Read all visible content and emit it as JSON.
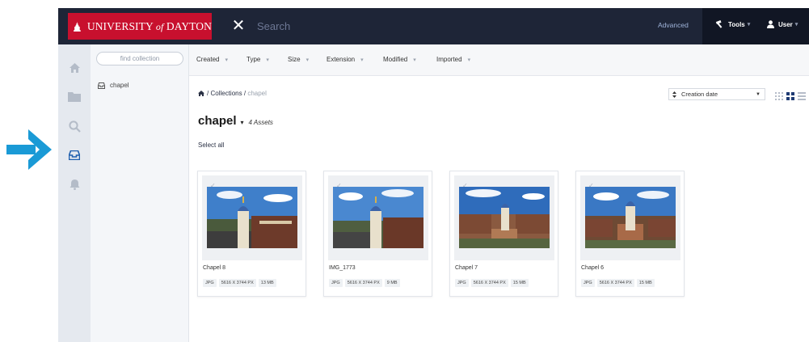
{
  "brand": {
    "name_part1": "UNIVERSITY",
    "name_of": "of",
    "name_part2": "DAYTON"
  },
  "search": {
    "placeholder": "Search"
  },
  "topbar": {
    "advanced": "Advanced",
    "tools": "Tools",
    "user": "User"
  },
  "collections_panel": {
    "find_placeholder": "find collection",
    "items": [
      {
        "label": "chapel"
      }
    ]
  },
  "filters": [
    "Created",
    "Type",
    "Size",
    "Extension",
    "Modified",
    "Imported"
  ],
  "breadcrumb": {
    "collections": "Collections",
    "separator": "/",
    "current": "chapel"
  },
  "sort": {
    "selected": "Creation date"
  },
  "collection": {
    "title": "chapel",
    "asset_count": "4 Assets",
    "select_all": "Select all"
  },
  "assets": [
    {
      "title": "Chapel 8",
      "type": "JPG",
      "dimensions": "5616 X 3744 PX",
      "size": "13 MB"
    },
    {
      "title": "IMG_1773",
      "type": "JPG",
      "dimensions": "5616 X 3744 PX",
      "size": "9 MB"
    },
    {
      "title": "Chapel 7",
      "type": "JPG",
      "dimensions": "5616 X 3744 PX",
      "size": "15 MB"
    },
    {
      "title": "Chapel 6",
      "type": "JPG",
      "dimensions": "5616 X 3744 PX",
      "size": "15 MB"
    }
  ],
  "icons": {
    "callout": "arrow-right-icon",
    "rail": [
      "home-icon",
      "folder-icon",
      "search-icon",
      "inbox-icon",
      "bell-icon"
    ],
    "tools": "hammer-icon",
    "user": "user-icon",
    "collection": "inbox-icon"
  },
  "colors": {
    "brand_red": "#c8102e",
    "topbar": "#1e2537",
    "callout_blue": "#1a9ad6",
    "rail": "#e5e9ef"
  }
}
